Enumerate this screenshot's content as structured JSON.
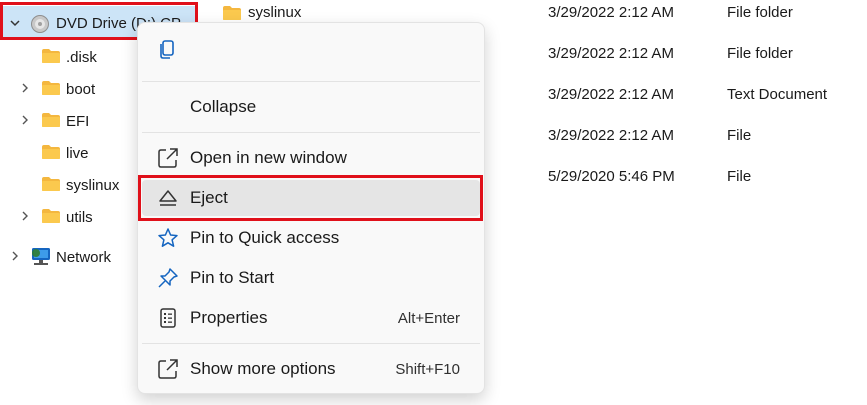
{
  "tree": {
    "root": {
      "label": "DVD Drive (D:) CP...",
      "expanded": true
    },
    "children": [
      {
        "label": ".disk",
        "expandable": false
      },
      {
        "label": "boot",
        "expandable": true
      },
      {
        "label": "EFI",
        "expandable": true
      },
      {
        "label": "live",
        "expandable": false
      },
      {
        "label": "syslinux",
        "expandable": false
      },
      {
        "label": "utils",
        "expandable": true
      }
    ],
    "network": {
      "label": "Network",
      "expandable": true
    }
  },
  "files": [
    {
      "name": "syslinux",
      "date": "3/29/2022 2:12 AM",
      "type": "File folder",
      "icon": "folder-icon"
    },
    {
      "name": "",
      "date": "3/29/2022 2:12 AM",
      "type": "File folder",
      "icon": ""
    },
    {
      "name": "",
      "date": "3/29/2022 2:12 AM",
      "type": "Text Document",
      "icon": ""
    },
    {
      "name": "",
      "date": "3/29/2022 2:12 AM",
      "type": "File",
      "icon": ""
    },
    {
      "name": "",
      "date": "5/29/2020 5:46 PM",
      "type": "File",
      "icon": ""
    }
  ],
  "context_menu": {
    "top_icon": "copy-icon",
    "items": [
      {
        "label": "Collapse",
        "icon": "",
        "shortcut": ""
      },
      {
        "label": "Open in new window",
        "icon": "open-new-window-icon",
        "shortcut": ""
      },
      {
        "label": "Eject",
        "icon": "eject-icon",
        "shortcut": "",
        "highlighted": true
      },
      {
        "label": "Pin to Quick access",
        "icon": "star-icon",
        "shortcut": ""
      },
      {
        "label": "Pin to Start",
        "icon": "pin-icon",
        "shortcut": ""
      },
      {
        "label": "Properties",
        "icon": "properties-icon",
        "shortcut": "Alt+Enter"
      },
      {
        "label": "Show more options",
        "icon": "more-options-icon",
        "shortcut": "Shift+F10"
      }
    ]
  },
  "colors": {
    "selection": "#cce4f7",
    "highlight_box": "#e0101a",
    "folder": "#f4b73f",
    "accent": "#1565c0"
  }
}
